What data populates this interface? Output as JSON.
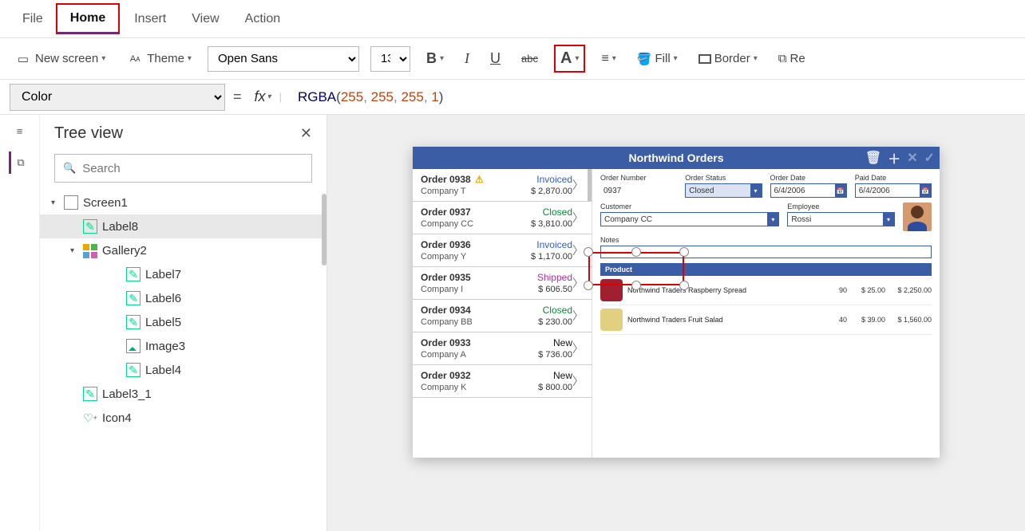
{
  "menu": {
    "file": "File",
    "home": "Home",
    "insert": "Insert",
    "view": "View",
    "action": "Action"
  },
  "ribbon": {
    "new_screen": "New screen",
    "theme": "Theme",
    "font": "Open Sans",
    "size": "13",
    "fill": "Fill",
    "border": "Border",
    "re": "Re"
  },
  "formula": {
    "property": "Color",
    "fn": "RGBA",
    "args": [
      "255",
      "255",
      "255",
      "1"
    ]
  },
  "tree": {
    "title": "Tree view",
    "search_ph": "Search",
    "items": [
      {
        "label": "Screen1",
        "depth": 0,
        "icon": "screen",
        "arrow": "▾"
      },
      {
        "label": "Label8",
        "depth": 1,
        "icon": "label",
        "selected": true
      },
      {
        "label": "Gallery2",
        "depth": 1,
        "icon": "gallery",
        "arrow": "▾"
      },
      {
        "label": "Label7",
        "depth": 2,
        "icon": "label"
      },
      {
        "label": "Label6",
        "depth": 2,
        "icon": "label"
      },
      {
        "label": "Label5",
        "depth": 2,
        "icon": "label"
      },
      {
        "label": "Image3",
        "depth": 2,
        "icon": "image"
      },
      {
        "label": "Label4",
        "depth": 2,
        "icon": "label"
      },
      {
        "label": "Label3_1",
        "depth": 1,
        "icon": "label"
      },
      {
        "label": "Icon4",
        "depth": 1,
        "icon": "icon4"
      }
    ]
  },
  "app": {
    "title": "Northwind Orders",
    "orders": [
      {
        "id": "Order 0938",
        "company": "Company T",
        "status": "Invoiced",
        "status_class": "stat-invoiced",
        "price": "$ 2,870.00",
        "warn": true
      },
      {
        "id": "Order 0937",
        "company": "Company CC",
        "status": "Closed",
        "status_class": "stat-closed",
        "price": "$ 3,810.00"
      },
      {
        "id": "Order 0936",
        "company": "Company Y",
        "status": "Invoiced",
        "status_class": "stat-invoiced",
        "price": "$ 1,170.00"
      },
      {
        "id": "Order 0935",
        "company": "Company I",
        "status": "Shipped",
        "status_class": "stat-shipped",
        "price": "$ 606.50"
      },
      {
        "id": "Order 0934",
        "company": "Company BB",
        "status": "Closed",
        "status_class": "stat-closed",
        "price": "$ 230.00"
      },
      {
        "id": "Order 0933",
        "company": "Company A",
        "status": "New",
        "status_class": "stat-new",
        "price": "$ 736.00"
      },
      {
        "id": "Order 0932",
        "company": "Company K",
        "status": "New",
        "status_class": "stat-new",
        "price": "$ 800.00"
      }
    ],
    "detail": {
      "labels": {
        "order_number": "Order Number",
        "order_status": "Order Status",
        "order_date": "Order Date",
        "paid_date": "Paid Date",
        "customer": "Customer",
        "employee": "Employee",
        "notes": "Notes",
        "product": "Product"
      },
      "order_number": "0937",
      "order_status": "Closed",
      "order_date": "6/4/2006",
      "paid_date": "6/4/2006",
      "customer": "Company CC",
      "employee": "Rossi",
      "products": [
        {
          "name": "Northwind Traders Raspberry Spread",
          "qty": "90",
          "unit": "$ 25.00",
          "total": "$ 2,250.00",
          "thumb": "#a02030"
        },
        {
          "name": "Northwind Traders Fruit Salad",
          "qty": "40",
          "unit": "$ 39.00",
          "total": "$ 1,560.00",
          "thumb": "#e0d080"
        }
      ]
    }
  }
}
